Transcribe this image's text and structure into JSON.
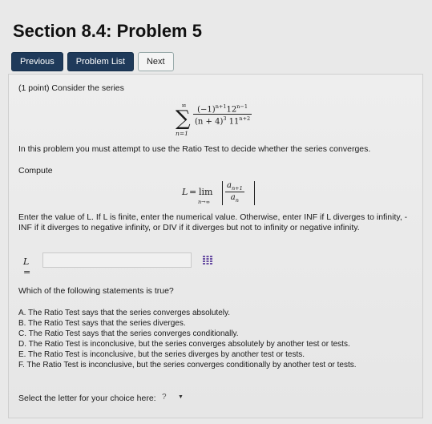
{
  "page": {
    "title": "Section 8.4: Problem 5"
  },
  "nav": {
    "previous": "Previous",
    "problem_list": "Problem List",
    "next": "Next"
  },
  "problem": {
    "intro": "(1 point) Consider the series",
    "series": {
      "upper_limit": "∞",
      "lower_limit": "n=1",
      "numerator_base": "(−1)",
      "numerator_exp1": "n+1",
      "numerator_mid": "12",
      "numerator_exp2": "n−1",
      "denominator_base": "(n + 4)",
      "denominator_exp1": "3",
      "denominator_mid": " 11",
      "denominator_exp2": "n+2"
    },
    "ratio_prompt": "In this problem you must attempt to use the Ratio Test to decide whether the series converges.",
    "compute_label": "Compute",
    "limit": {
      "L": "L",
      "eq": "=",
      "lim": "lim",
      "sub": "n→∞",
      "num": "a",
      "num_sub": "n+1",
      "den": "a",
      "den_sub": "n"
    },
    "enter_line1": "Enter the value of L. If L is finite, enter the numerical value. Otherwise, enter INF if L diverges to infinity, -",
    "enter_line2": "INF if it diverges to negative infinity, or DIV if it diverges but not to infinity or negative infinity.",
    "answer": {
      "label": "L =",
      "value": "",
      "placeholder": ""
    },
    "question": "Which of the following statements is true?",
    "options": [
      "A. The Ratio Test says that the series converges absolutely.",
      "B. The Ratio Test says that the series diverges.",
      "C. The Ratio Test says that the series converges conditionally.",
      "D. The Ratio Test is inconclusive, but the series converges absolutely by another test or tests.",
      "E. The Ratio Test is inconclusive, but the series diverges by another test or tests.",
      "F. The Ratio Test is inconclusive, but the series converges conditionally by another test or tests."
    ],
    "select_label": "Select the letter for your choice here:",
    "select_value": "?"
  },
  "colors": {
    "nav_dark": "#1f3a5a",
    "background": "#e9e9e9"
  }
}
